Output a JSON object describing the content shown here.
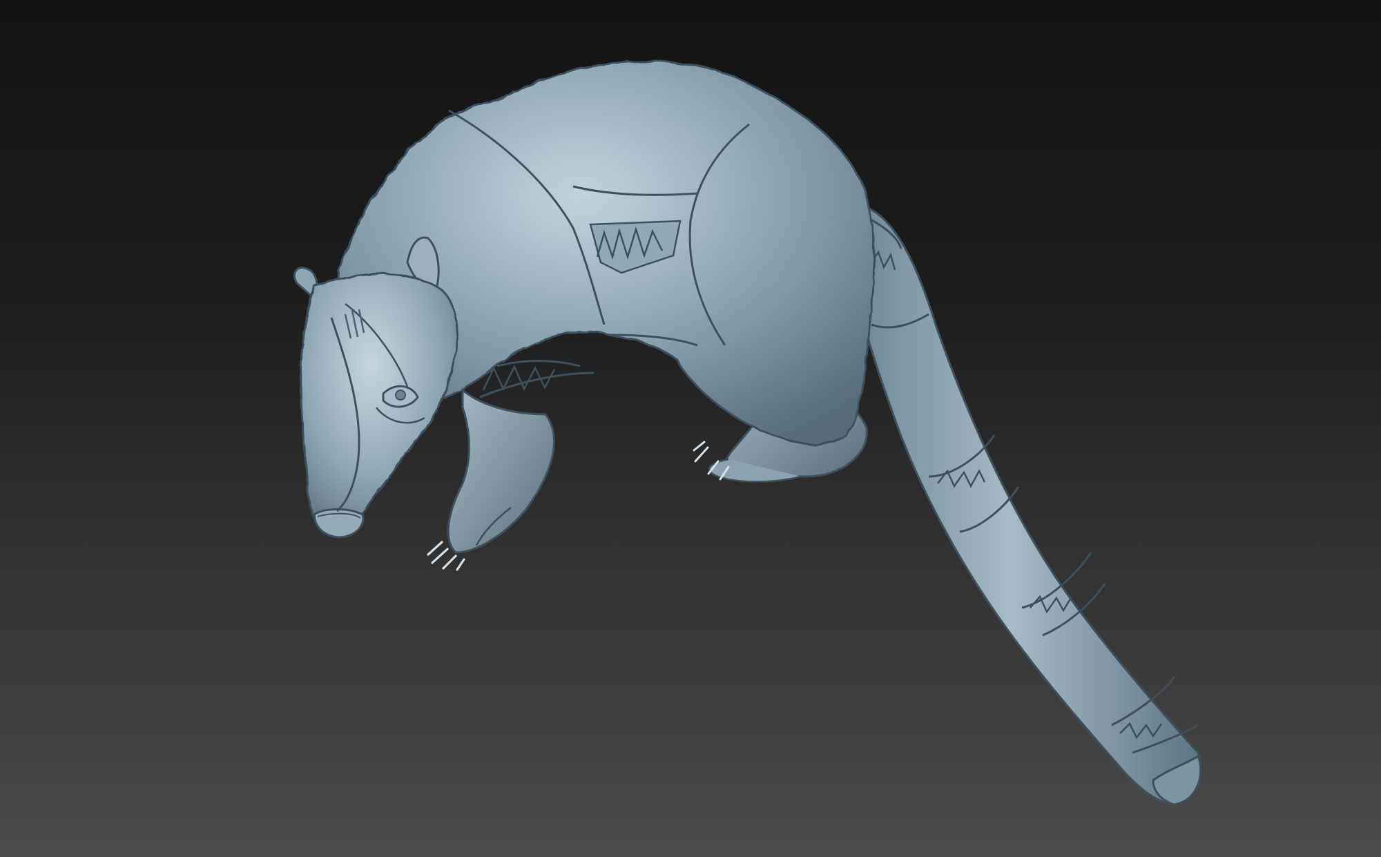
{
  "scene": {
    "background_top_color": "#141414",
    "background_bottom_color": "#4c4c4c",
    "model": {
      "subject": "coati-sculpture",
      "material_color": "#8ea5b2",
      "shadow_color": "#4f6472",
      "highlight_color": "#c9d8e0",
      "engraving_color": "#3e505c"
    }
  }
}
